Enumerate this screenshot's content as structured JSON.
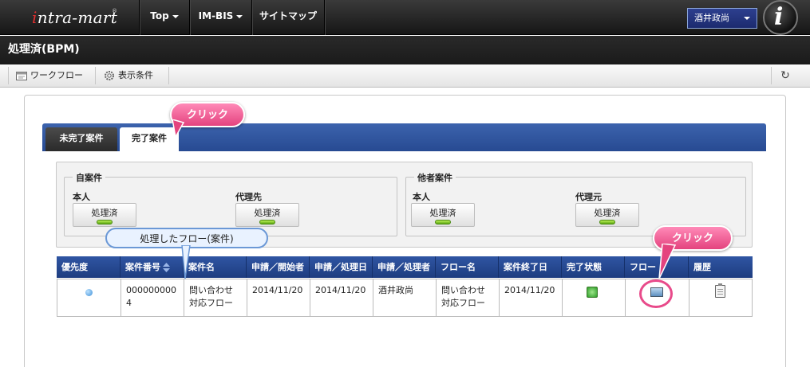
{
  "navbar": {
    "logo_prefix": "i",
    "logo_text": "ntra-mart",
    "logo_mark": "®",
    "items": [
      {
        "label": "Top",
        "has_caret": true
      },
      {
        "label": "IM-BIS",
        "has_caret": true
      },
      {
        "label": "サイトマップ",
        "has_caret": false
      }
    ],
    "user_label": "酒井政尚",
    "brand_icon_letter": "i"
  },
  "page_title": "処理済(BPM)",
  "toolbar": {
    "workflow_label": "ワークフロー",
    "conditions_label": "表示条件",
    "refresh_icon": "refresh-icon"
  },
  "tabs": [
    {
      "label": "未完了案件",
      "active": false
    },
    {
      "label": "完了案件",
      "active": true
    }
  ],
  "filters": {
    "own": {
      "legend": "自案件",
      "groups": [
        {
          "label": "本人",
          "button": "処理済"
        },
        {
          "label": "代理先",
          "button": "処理済"
        }
      ]
    },
    "others": {
      "legend": "他者案件",
      "groups": [
        {
          "label": "本人",
          "button": "処理済"
        },
        {
          "label": "代理元",
          "button": "処理済"
        }
      ]
    }
  },
  "table": {
    "columns": [
      "優先度",
      "案件番号",
      "案件名",
      "申請／開始者",
      "申請／処理日",
      "申請／処理者",
      "フロー名",
      "案件終了日",
      "完了状態",
      "フロー",
      "履歴"
    ],
    "rows": [
      {
        "matter_no_line1": "000000000",
        "matter_no_line2": "4",
        "matter_name_line1": "問い合わせ",
        "matter_name_line2": "対応フロー",
        "apply_start": "2014/11/20",
        "apply_process": "2014/11/20",
        "applicant": "酒井政尚",
        "flow_name_line1": "問い合わせ",
        "flow_name_line2": "対応フロー",
        "end_date": "2014/11/20"
      }
    ]
  },
  "callouts": {
    "click_tab": "クリック",
    "click_flow": "クリック",
    "processed_flow": "処理したフロー(案件)"
  },
  "colors": {
    "accent_blue": "#2f55a3",
    "callout_pink": "#e4437e",
    "status_green": "#2e9e2a"
  }
}
